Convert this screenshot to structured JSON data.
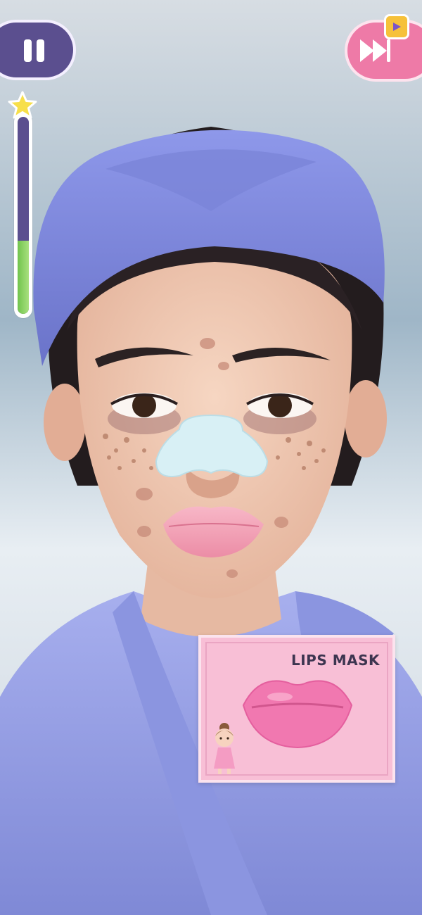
{
  "hud": {
    "pause_icon": "pause-icon",
    "fast_forward_icon": "fast-forward-icon",
    "ad_badge_icon": "video-ad-icon",
    "progress": {
      "value_fraction": 0.37,
      "icon": "star-icon"
    }
  },
  "item_card": {
    "title": "LIPS MASK",
    "item_icon": "lips-mask-icon",
    "mascot_icon": "mascot-girl-icon"
  },
  "colors": {
    "pause_button": "#5b4f8f",
    "ff_button": "#ee7aa7",
    "progress_fill": "#71c44d",
    "card_bg": "#f8bfd6",
    "headband": "#7f8ae0",
    "robe": "#9ba4e6"
  }
}
